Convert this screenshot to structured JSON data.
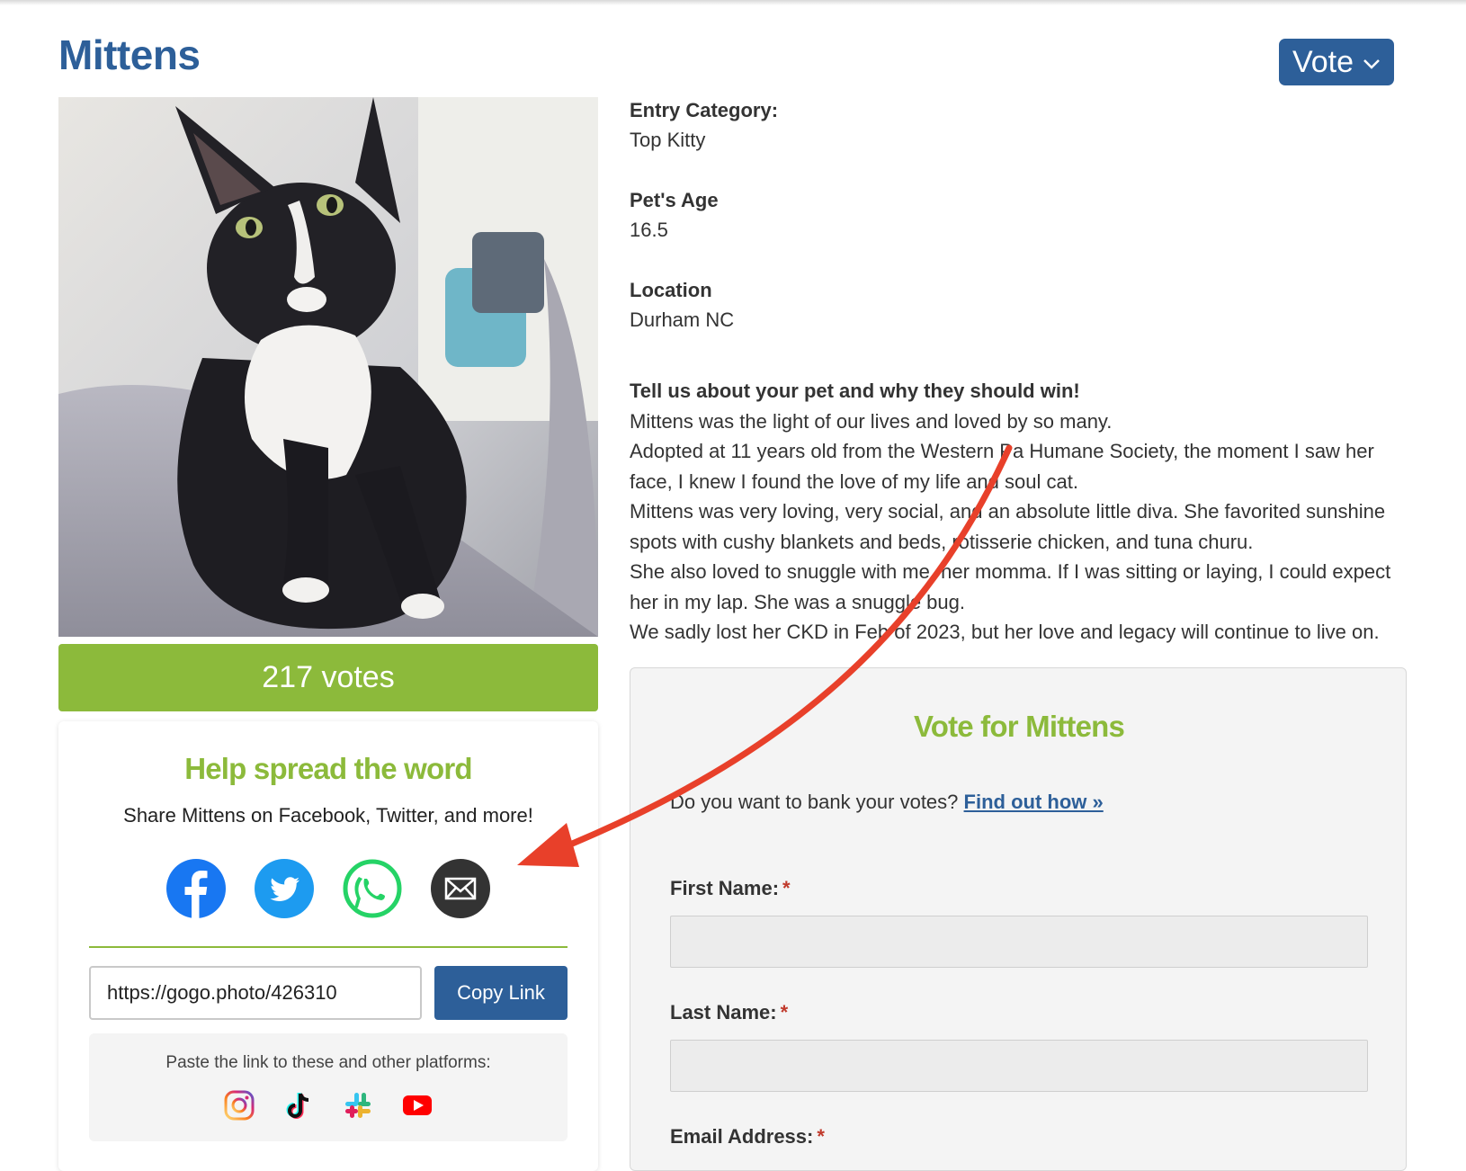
{
  "page": {
    "title": "Mittens",
    "vote_button": "Vote"
  },
  "votes": {
    "label": "217 votes"
  },
  "share": {
    "title": "Help spread the word",
    "subtitle": "Share Mittens on Facebook, Twitter, and more!",
    "social_icons": [
      "facebook-icon",
      "twitter-icon",
      "whatsapp-icon",
      "email-icon"
    ],
    "link_value": "https://gogo.photo/426310",
    "copy_button": "Copy Link",
    "paste_text": "Paste the link to these and other platforms:",
    "platform_icons": [
      "instagram-icon",
      "tiktok-icon",
      "slack-icon",
      "youtube-icon"
    ]
  },
  "entry": {
    "category_label": "Entry Category:",
    "category_value": "Top Kitty",
    "age_label": "Pet's Age",
    "age_value": "16.5",
    "location_label": "Location",
    "location_value": "Durham NC",
    "about_label": "Tell us about your pet and why they should win!",
    "about_lines": [
      "Mittens was the light of our lives and loved by so many.",
      "Adopted at 11 years old from the Western Pa Humane Society, the moment I saw her",
      "face, I knew I found the love of my life and soul cat.",
      "Mittens was very loving, very social, and an absolute little diva. She favorited sunshine",
      "spots with cushy blankets and beds, rotisserie chicken, and tuna churu.",
      "She also loved to snuggle with me, her momma. If I was sitting or laying, I could expect",
      "her in my lap. She was a snuggle bug.",
      "We sadly lost her CKD in Feb of 2023, but her love and legacy will continue to live on."
    ]
  },
  "vote_form": {
    "title": "Vote for Mittens",
    "bank_text": "Do you want to bank your votes?",
    "bank_link": "Find out how »",
    "first_name_label": "First Name:",
    "last_name_label": "Last Name:",
    "email_label": "Email Address:",
    "required_mark": "*"
  },
  "colors": {
    "brand_blue": "#2d5f99",
    "brand_green": "#8cba3b",
    "annotation_arrow": "#e8402a"
  }
}
